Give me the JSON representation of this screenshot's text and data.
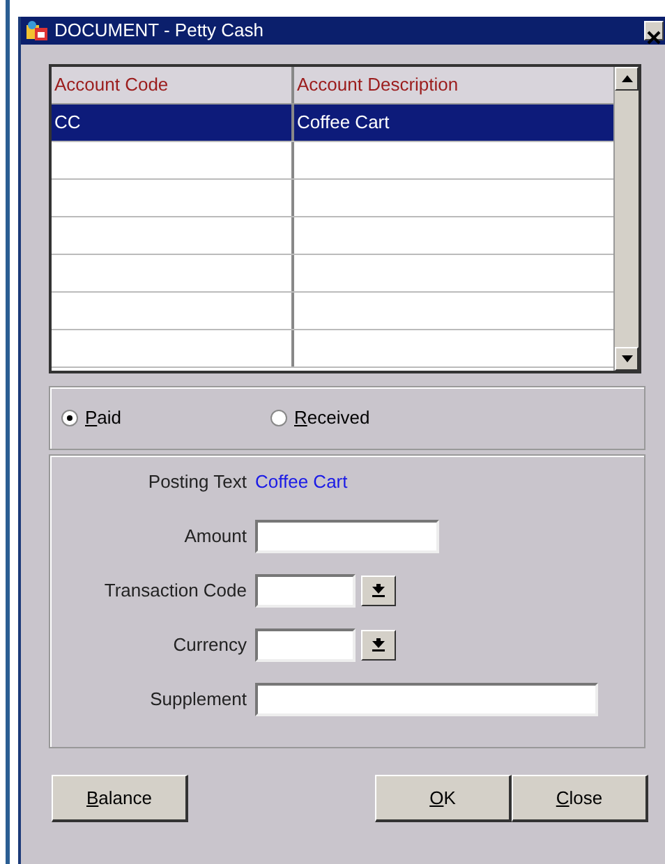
{
  "window": {
    "title": "DOCUMENT - Petty Cash"
  },
  "table": {
    "columns": [
      "Account Code",
      "Account Description"
    ],
    "rows": [
      {
        "cells": [
          "CC",
          "Coffee Cart"
        ],
        "selected": true
      }
    ]
  },
  "radios": [
    {
      "label": "Paid",
      "selected": true
    },
    {
      "label": "Received",
      "selected": false
    }
  ],
  "posting_text": {
    "label": "Posting Text",
    "value": "Coffee Cart"
  },
  "fields": [
    {
      "label": "Amount",
      "kind": "text"
    },
    {
      "label": "Transaction Code",
      "kind": "dropdown"
    },
    {
      "label": "Currency",
      "kind": "dropdown"
    },
    {
      "label": "Supplement",
      "kind": "text"
    }
  ],
  "buttons": [
    {
      "label": "Balance"
    },
    {
      "label": "OK"
    },
    {
      "label": "Close"
    }
  ]
}
